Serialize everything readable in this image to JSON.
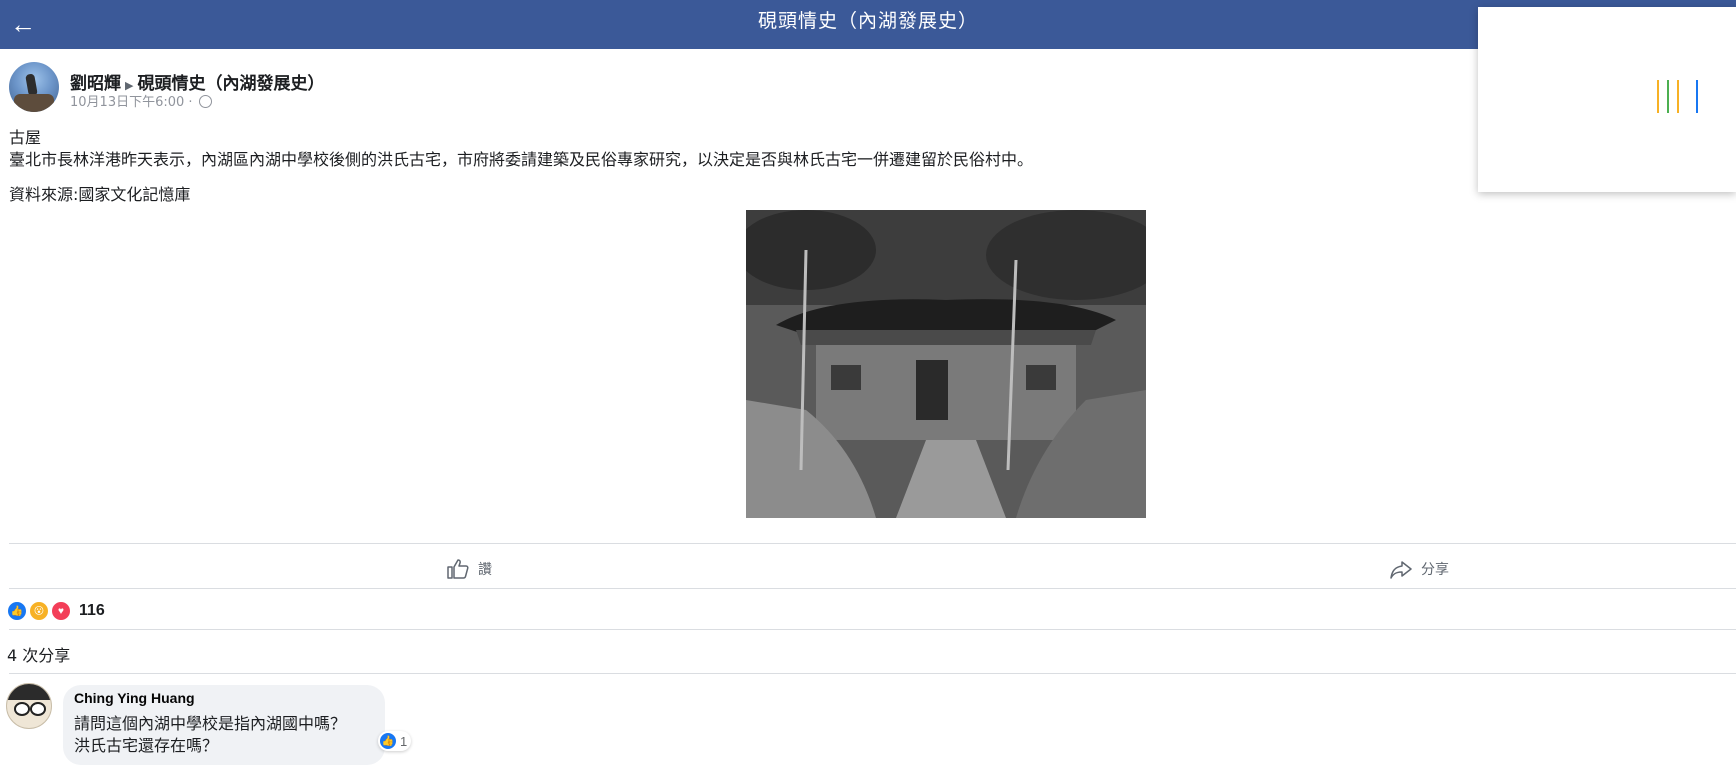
{
  "header": {
    "back_icon": "arrow-left-icon",
    "title": "硯頭情史（內湖發展史）"
  },
  "post": {
    "author": "劉昭輝",
    "group": "硯頭情史（內湖發展史）",
    "timestamp": "10月13日下午6:00 ·",
    "privacy_icon": "globe-icon",
    "text_line1": "古屋",
    "text_line2": "臺北市長林洋港昨天表示，內湖區內湖中學校後側的洪氏古宅，市府將委請建築及民俗專家研究，以決定是否與林氏古宅一併遷建留於民俗村中。",
    "source": "資料來源:國家文化記憶庫"
  },
  "actions": {
    "like_label": "讚",
    "share_label": "分享"
  },
  "stats": {
    "reaction_count": "116",
    "shares_text": "4 次分享"
  },
  "comment": {
    "author": "Ching Ying Huang",
    "line1": "請問這個內湖中學校是指內湖國中嗎？",
    "line2": "洪氏古宅還存在嗎？",
    "like_count": "1"
  },
  "colors": {
    "header_bg": "#3b5998",
    "like_blue": "#1877f2",
    "love_red": "#f33e58",
    "wow_yellow": "#f7b125",
    "loader_bars": [
      "#f7b125",
      "#4caf50",
      "#f33e58",
      "#1877f2"
    ]
  }
}
